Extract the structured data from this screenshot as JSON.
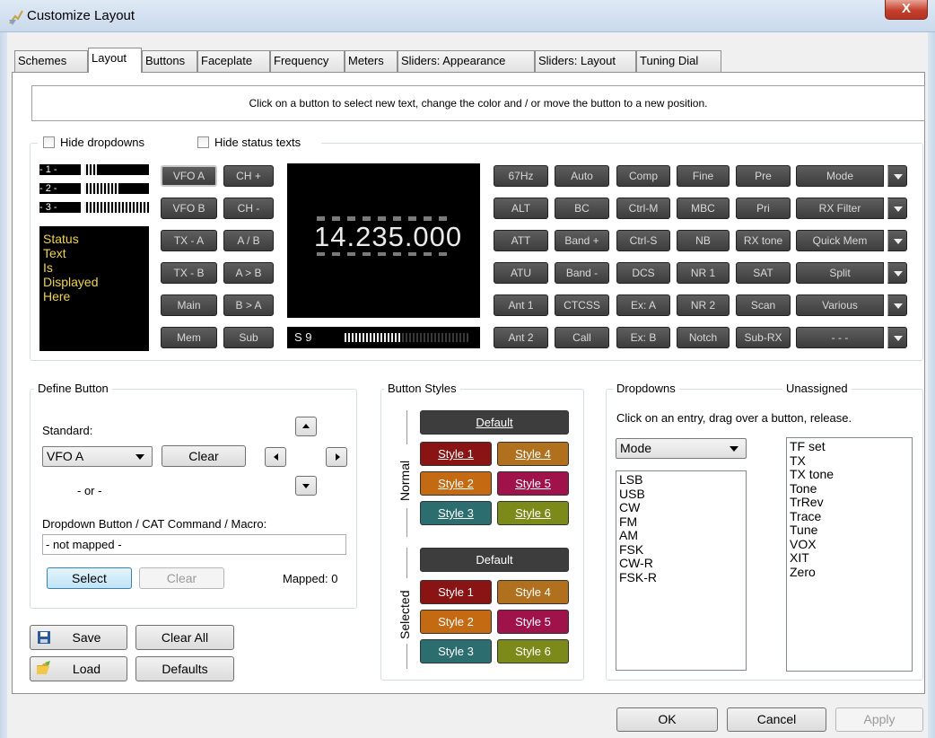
{
  "window": {
    "title": "Customize Layout",
    "close_glyph": "X"
  },
  "tabs": [
    "Schemes",
    "Layout",
    "Buttons",
    "Faceplate",
    "Frequency",
    "Meters",
    "Sliders: Appearance",
    "Sliders: Layout",
    "Tuning Dial"
  ],
  "active_tab": "Layout",
  "instruction": "Click on a button to select new text, change the color and / or move the button to a new position.",
  "checkboxes": {
    "hide_dropdowns": "Hide dropdowns",
    "hide_status_texts": "Hide status texts"
  },
  "meters": [
    {
      "label": "- 1 -",
      "level": 0.2
    },
    {
      "label": "- 2 -",
      "level": 0.55
    },
    {
      "label": "- 3 -",
      "level": 1.0
    }
  ],
  "status_text": [
    "Status",
    "Text",
    "Is",
    "Displayed",
    "Here"
  ],
  "vfo_buttons": [
    [
      "VFO A",
      "CH +"
    ],
    [
      "VFO B",
      "CH -"
    ],
    [
      "TX - A",
      "A / B"
    ],
    [
      "TX - B",
      "A > B"
    ],
    [
      "Main",
      "B > A"
    ],
    [
      "Mem",
      "Sub"
    ]
  ],
  "frequency": "14.235.000",
  "smeter": {
    "label": "S 9",
    "level": 0.45
  },
  "function_buttons": [
    [
      "67Hz",
      "Auto",
      "Comp",
      "Fine",
      "Pre"
    ],
    [
      "ALT",
      "BC",
      "Ctrl-M",
      "MBC",
      "Pri"
    ],
    [
      "ATT",
      "Band +",
      "Ctrl-S",
      "NB",
      "RX tone"
    ],
    [
      "ATU",
      "Band -",
      "DCS",
      "NR 1",
      "SAT"
    ],
    [
      "Ant 1",
      "CTCSS",
      "Ex: A",
      "NR 2",
      "Scan"
    ],
    [
      "Ant 2",
      "Call",
      "Ex: B",
      "Notch",
      "Sub-RX"
    ]
  ],
  "dropdown_buttons": [
    "Mode",
    "RX Filter",
    "Quick Mem",
    "Split",
    "Various",
    "- - -"
  ],
  "define_button": {
    "legend": "Define Button",
    "standard_label": "Standard:",
    "standard_value": "VFO A",
    "clear_label": "Clear",
    "or_label": "- or -",
    "dropdown_label": "Dropdown Button / CAT Command / Macro:",
    "mapping_value": "- not mapped -",
    "select_label": "Select",
    "clear2_label": "Clear",
    "mapped_label": "Mapped: 0"
  },
  "file_buttons": {
    "save": "Save",
    "clear_all": "Clear All",
    "load": "Load",
    "defaults": "Defaults"
  },
  "button_styles": {
    "legend": "Button Styles",
    "normal_label": "Normal",
    "selected_label": "Selected",
    "normal_default": "Default",
    "selected_default": "Default",
    "normal": [
      "Style 1",
      "Style 4",
      "Style 2",
      "Style 5",
      "Style 3",
      "Style 6"
    ],
    "selected": [
      "Style 1",
      "Style 4",
      "Style 2",
      "Style 5",
      "Style 3",
      "Style 6"
    ],
    "colors": {
      "default": "#3d3d3d",
      "style1": "#8a1414",
      "style2": "#c46a12",
      "style3": "#2c6e70",
      "style4": "#b0701e",
      "style5": "#a0124a",
      "style6": "#7c8a1a"
    }
  },
  "dropdowns": {
    "legend": "Dropdowns",
    "unassigned_legend": "Unassigned",
    "hint": "Click on an entry, drag over a button, release.",
    "selected": "Mode",
    "items": [
      "LSB",
      "USB",
      "CW",
      "FM",
      "AM",
      "FSK",
      "CW-R",
      "FSK-R"
    ],
    "unassigned": [
      "TF set",
      "TX",
      "TX tone",
      "Tone",
      "TrRev",
      "Trace",
      "Tune",
      "VOX",
      "XIT",
      "Zero"
    ]
  },
  "dialog_buttons": {
    "ok": "OK",
    "cancel": "Cancel",
    "apply": "Apply"
  }
}
